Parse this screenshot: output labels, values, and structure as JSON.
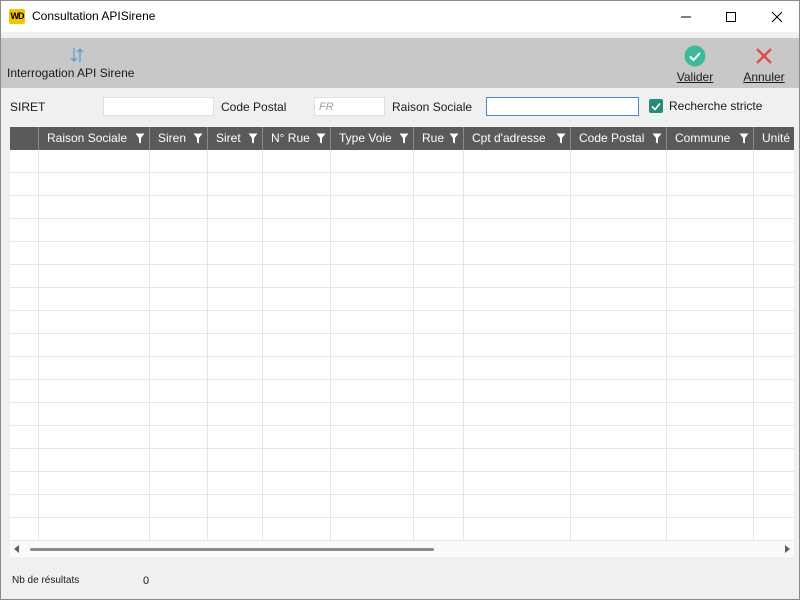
{
  "window": {
    "title": "Consultation APISirene",
    "logo_text": "WD"
  },
  "toolbar": {
    "interrogation_label": "Interrogation API Sirene",
    "valider_label": "Valider",
    "annuler_label": "Annuler"
  },
  "filters": {
    "siret_label": "SIRET",
    "siret_value": "",
    "code_postal_label": "Code Postal",
    "code_postal_placeholder": "FR",
    "raison_sociale_label": "Raison Sociale",
    "raison_sociale_value": "",
    "recherche_stricte_label": "Recherche stricte",
    "recherche_stricte_checked": true
  },
  "grid": {
    "columns": [
      "Raison Sociale",
      "Siren",
      "Siret",
      "N° Rue",
      "Type Voie",
      "Rue",
      "Cpt d'adresse",
      "Code Postal",
      "Commune",
      "Unité"
    ],
    "rows": []
  },
  "footer": {
    "nb_resultats_label": "Nb de résultats",
    "nb_resultats_value": "0"
  },
  "colors": {
    "toolbar_bg": "#c8c8c8",
    "header_bg": "#5a5a5a",
    "valider_green": "#3db89a",
    "annuler_red": "#e04b4b",
    "checkbox_teal": "#2a8a78"
  }
}
